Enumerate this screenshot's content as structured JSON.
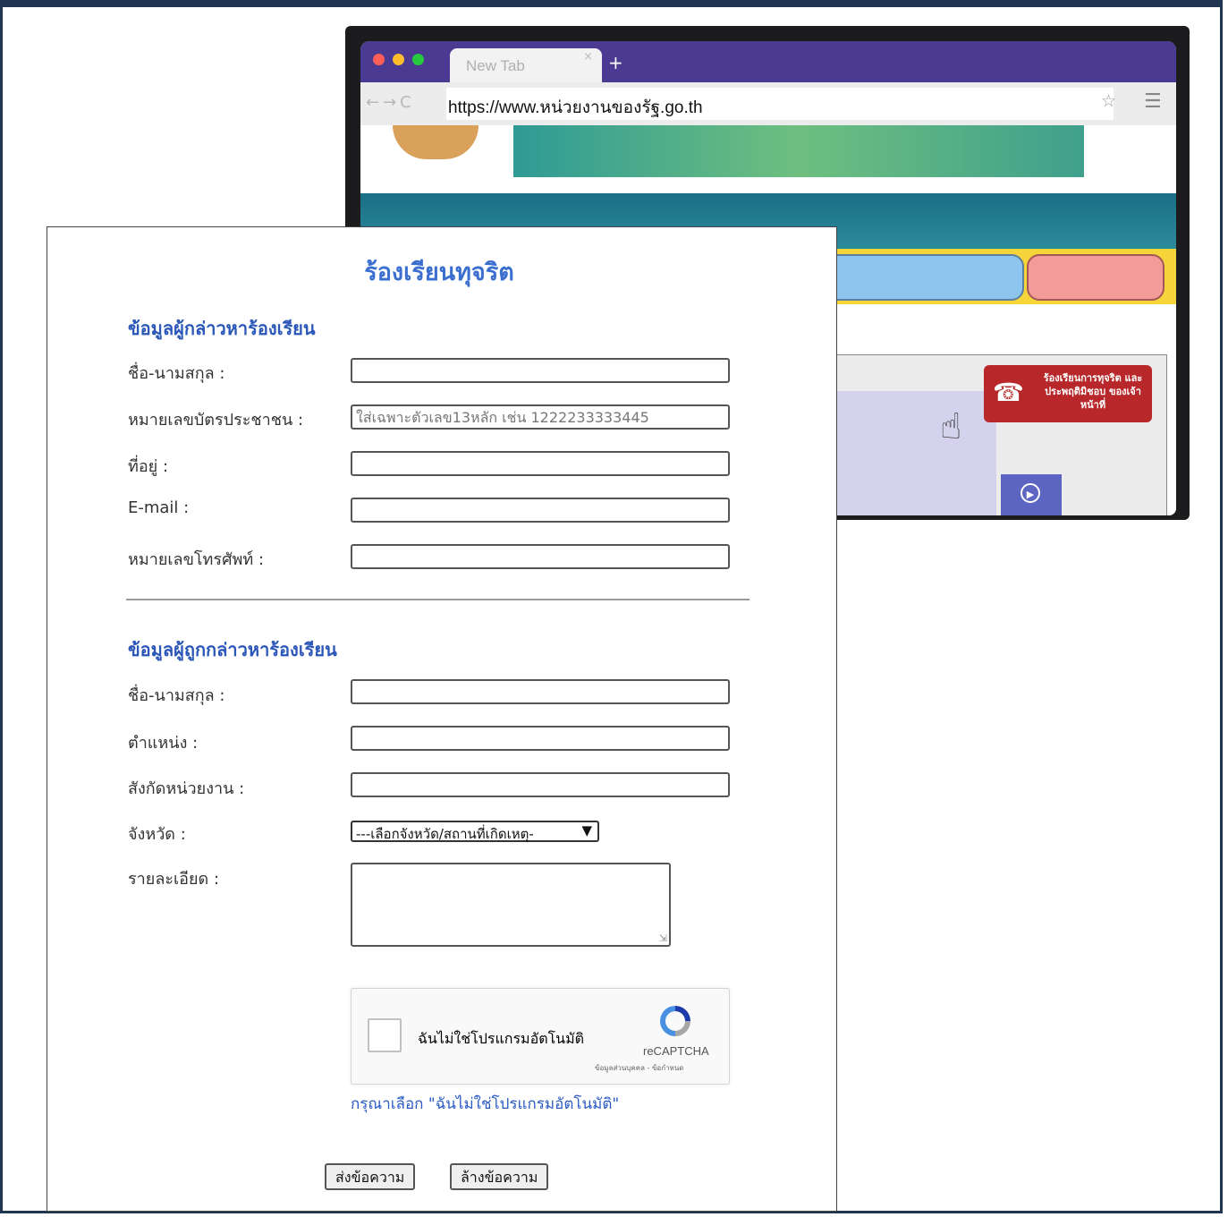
{
  "browser": {
    "tab_label": "New Tab",
    "tab_close": "×",
    "new_tab": "+",
    "nav_icons": "←→C",
    "url": "https://www.หน่วยงานของรัฐ.go.th",
    "star": "☆",
    "menu": "☰",
    "badge_text": "ร้องเรียนการทุจริต และประพฤติมิชอบ ของเจ้าหน้าที่",
    "colors": {
      "tabbar": "#4b3a91",
      "navbar": "#1b6f86",
      "yellow": "#f6d53b",
      "badge": "#b8272a"
    }
  },
  "form": {
    "title": "ร้องเรียนทุจริต",
    "complainant": {
      "section_title": "ข้อมูลผู้กล่าวหาร้องเรียน",
      "fields": [
        {
          "label": "ชื่อ-นามสกุล :",
          "value": "",
          "placeholder": ""
        },
        {
          "label": "หมายเลขบัตรประชาชน :",
          "value": "",
          "placeholder": "ใส่เฉพาะตัวเลข13หลัก เช่น 1222233333445"
        },
        {
          "label": "ที่อยู่ :",
          "value": "",
          "placeholder": ""
        },
        {
          "label": "E-mail :",
          "value": "",
          "placeholder": ""
        },
        {
          "label": "หมายเลขโทรศัพท์ :",
          "value": "",
          "placeholder": ""
        }
      ]
    },
    "accused": {
      "section_title": "ข้อมูลผู้ถูกกล่าวหาร้องเรียน",
      "fields": [
        {
          "label": "ชื่อ-นามสกุล :",
          "value": ""
        },
        {
          "label": "ตำแหน่ง :",
          "value": ""
        },
        {
          "label": "สังกัดหน่วยงาน :",
          "value": ""
        }
      ],
      "province_label": "จังหวัด :",
      "province_selected": "---เลือกจังหวัด/สถานที่เกิดเหตุ-",
      "detail_label": "รายละเอียด :"
    },
    "captcha": {
      "label": "ฉันไม่ใช่โปรแกรมอัตโนมัติ",
      "brand": "reCAPTCHA",
      "links": "ข้อมูลส่วนบุคคล - ข้อกำหนด",
      "hint": "กรุณาเลือก \"ฉันไม่ใช่โปรแกรมอัตโนมัติ\""
    },
    "submit_label": "ส่งข้อความ",
    "reset_label": "ล้างข้อความ"
  }
}
